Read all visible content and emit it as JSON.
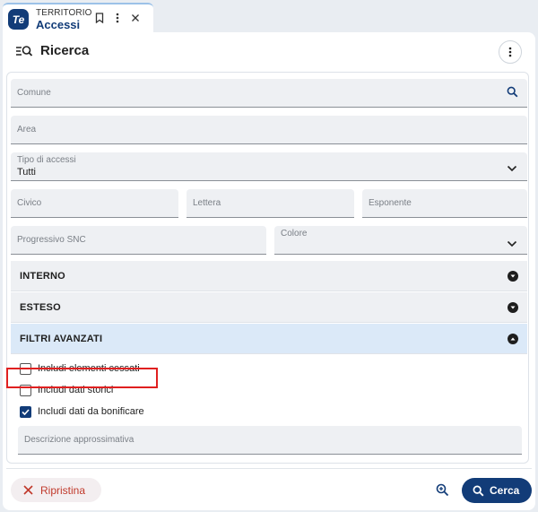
{
  "tab": {
    "logo": "Te",
    "overline": "TERRITORIO",
    "title": "Accessi"
  },
  "header": {
    "title": "Ricerca"
  },
  "fields": {
    "comune": {
      "placeholder": "Comune"
    },
    "area": {
      "placeholder": "Area"
    },
    "tipo_accessi": {
      "label": "Tipo di accessi",
      "value": "Tutti"
    },
    "civico": {
      "placeholder": "Civico"
    },
    "lettera": {
      "placeholder": "Lettera"
    },
    "esponente": {
      "placeholder": "Esponente"
    },
    "progressivo_snc": {
      "placeholder": "Progressivo SNC"
    },
    "colore": {
      "label": "Colore"
    },
    "descrizione": {
      "placeholder": "Descrizione approssimativa"
    }
  },
  "accordions": [
    {
      "label": "INTERNO",
      "expanded": false
    },
    {
      "label": "ESTESO",
      "expanded": false
    },
    {
      "label": "FILTRI AVANZATI",
      "expanded": true
    }
  ],
  "checkboxes": [
    {
      "label": "Includi elementi cessati",
      "checked": false
    },
    {
      "label": "Includi dati storici",
      "checked": false
    },
    {
      "label": "Includi dati da bonificare",
      "checked": true
    }
  ],
  "footer": {
    "reset_label": "Ripristina",
    "search_label": "Cerca"
  },
  "colors": {
    "primary": "#123c78",
    "danger": "#c0392b",
    "highlight": "#e02020",
    "active_accordion": "#dbe9f8"
  },
  "icons": {
    "tab": [
      "bookmark-icon",
      "kebab-icon",
      "close-icon"
    ],
    "header": [
      "search-list-icon",
      "kebab-icon"
    ],
    "fields": [
      "search-icon",
      "chevron-down-icon"
    ],
    "footer": [
      "close-icon",
      "zoom-in-icon",
      "search-icon"
    ]
  }
}
